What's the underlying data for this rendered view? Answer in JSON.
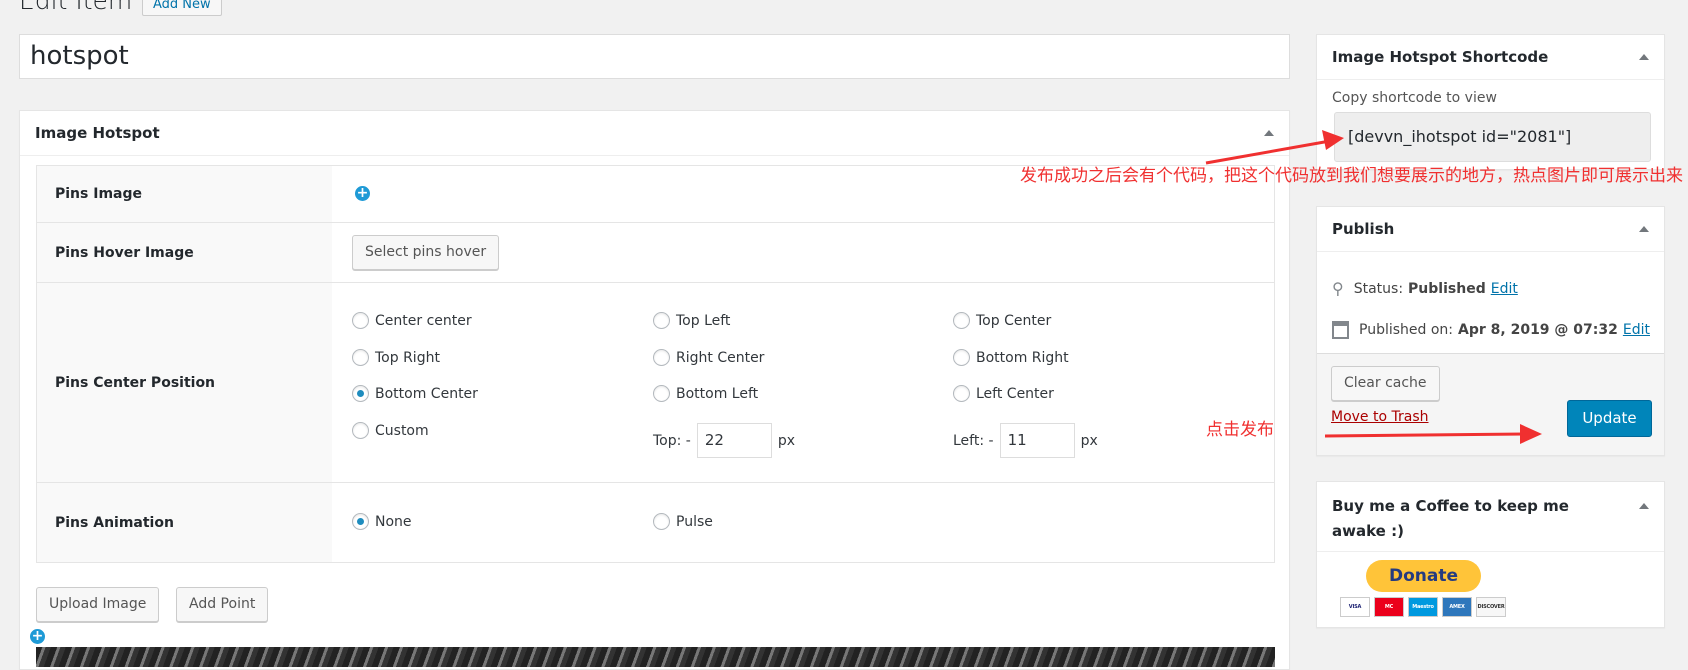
{
  "page": {
    "heading": "Edit Item",
    "add_new": "Add New",
    "post_title": "hotspot"
  },
  "hotspot_box": {
    "title": "Image Hotspot",
    "pins_image": "Pins Image",
    "pins_hover_image": "Pins Hover Image",
    "select_pins_hover": "Select pins hover",
    "pins_center_position": "Pins Center Position",
    "positions": [
      {
        "label": "Center center",
        "checked": false
      },
      {
        "label": "Top Left",
        "checked": false
      },
      {
        "label": "Top Center",
        "checked": false
      },
      {
        "label": "Top Right",
        "checked": false
      },
      {
        "label": "Right Center",
        "checked": false
      },
      {
        "label": "Bottom Right",
        "checked": false
      },
      {
        "label": "Bottom Center",
        "checked": true
      },
      {
        "label": "Bottom Left",
        "checked": false
      },
      {
        "label": "Left Center",
        "checked": false
      },
      {
        "label": "Custom",
        "checked": false
      }
    ],
    "top_label": "Top: -",
    "top_value": "22",
    "left_label": "Left: -",
    "left_value": "11",
    "px": "px",
    "pins_animation": "Pins Animation",
    "animations": [
      {
        "label": "None",
        "checked": true
      },
      {
        "label": "Pulse",
        "checked": false
      }
    ],
    "upload_image": "Upload Image",
    "add_point": "Add Point"
  },
  "shortcode_box": {
    "title": "Image Hotspot Shortcode",
    "hint": "Copy shortcode to view",
    "shortcode": "[devvn_ihotspot id=\"2081\"]"
  },
  "publish_box": {
    "title": "Publish",
    "status_label": "Status:",
    "status_value": "Published",
    "edit": "Edit",
    "published_on_label": "Published on:",
    "published_on_value": "Apr 8, 2019 @ 07:32",
    "clear_cache": "Clear cache",
    "move_to_trash": "Move to Trash",
    "update": "Update"
  },
  "coffee_box": {
    "title": "Buy me a Coffee to keep me awake :)",
    "donate": "Donate",
    "cards": [
      "VISA",
      "MC",
      "Maestro",
      "AMEX",
      "DISCOVER"
    ]
  },
  "annotations": {
    "shortcode_note": "发布成功之后会有个代码，把这个代码放到我们想要展示的地方，热点图片即可展示出来",
    "publish_note": "点击发布"
  },
  "colors": {
    "primary": "#0085ba",
    "annotation": "#f03030",
    "link": "#0073aa",
    "trash": "#a00"
  }
}
